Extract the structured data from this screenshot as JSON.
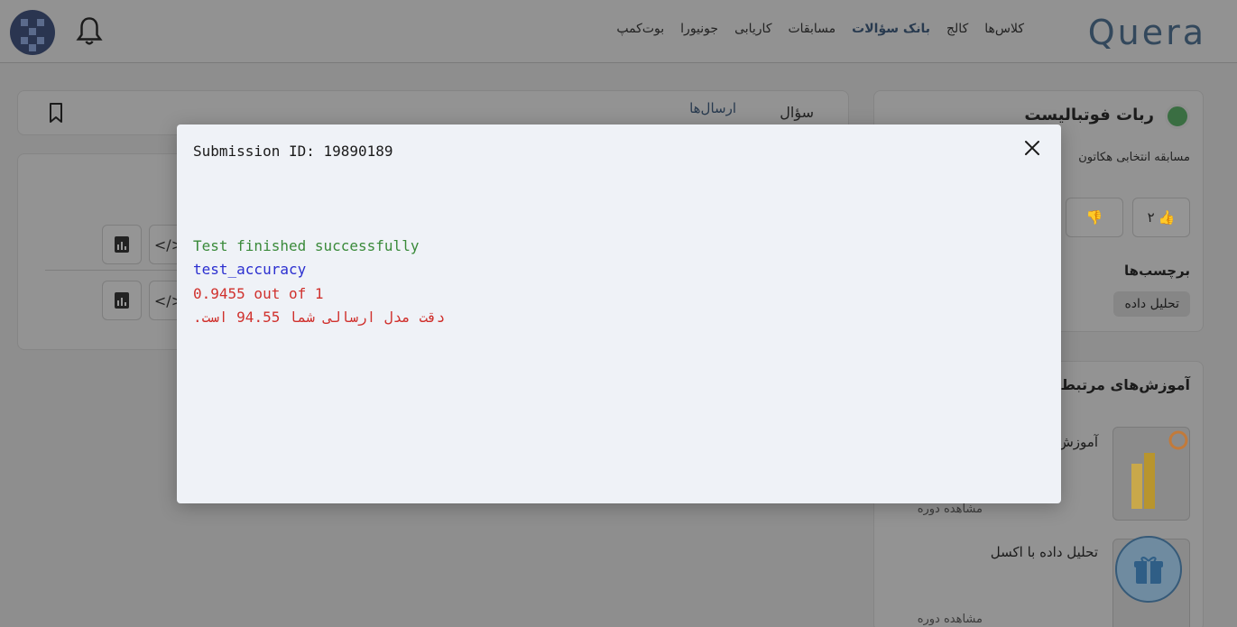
{
  "header": {
    "logo": "Quera",
    "nav": [
      "کلاس‌ها",
      "کالج",
      "بانک سؤالات",
      "مسابقات",
      "کاریابی",
      "جونیورا",
      "بوت‌کمپ"
    ],
    "active_nav": "بانک سؤالات"
  },
  "left": {
    "tabs": {
      "question": "سؤال",
      "submissions": "ارسال‌ها"
    }
  },
  "problem": {
    "title": "ربات فوتبالیست",
    "subtitle": "مسابقه انتخابی هکاتون",
    "likes": "۲",
    "tags_heading": "برچسب‌ها",
    "tags": [
      "تحلیل داده"
    ]
  },
  "related": {
    "heading": "آموزش‌های مرتبط",
    "courses": [
      {
        "title": "آموزش",
        "link": "مشاهده دوره"
      },
      {
        "title": "تحلیل داده با اکسل",
        "link": "مشاهده دوره"
      }
    ]
  },
  "modal": {
    "submission_id": "Submission ID: 19890189",
    "lines": [
      "Test finished successfully",
      "test_accuracy",
      "0.9455 out of 1",
      "دقت مدل ارسالی شما 94.55 است."
    ]
  },
  "colors": {
    "success": "#3a8a3a",
    "info": "#2b2fd0",
    "error": "#d0312d",
    "brand": "#33485c"
  }
}
